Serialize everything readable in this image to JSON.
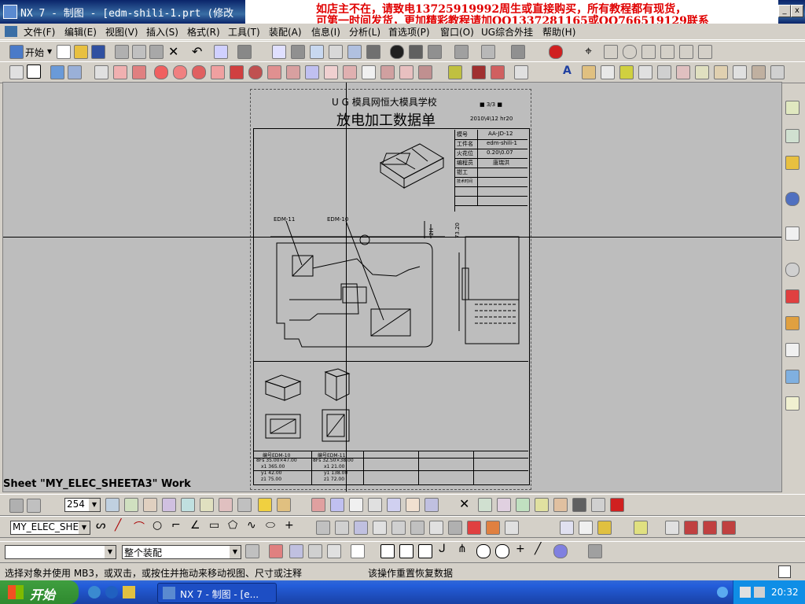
{
  "window": {
    "title": "NX 7 - 制图 - [edm-shili-1.prt (修改",
    "minimize_glyph": "_",
    "close_glyph": "x"
  },
  "promo": {
    "line1": "如店主不在，请致电13725919992周生或直接购买，所有教程都有现货，",
    "line2": "可第一时间发货，更加精彩教程请加QQ1337281165或QQ766519129联系"
  },
  "menubar": {
    "items": [
      "文件(F)",
      "编辑(E)",
      "视图(V)",
      "插入(S)",
      "格式(R)",
      "工具(T)",
      "装配(A)",
      "信息(I)",
      "分析(L)",
      "首选项(P)",
      "窗口(O)",
      "UG综合外挂",
      "帮助(H)"
    ]
  },
  "toolbar1": {
    "start_label": "开始"
  },
  "drawing": {
    "school": "U G 模具网恒大模具学校",
    "title": "放电加工数据单",
    "sheet_no": "■ 3/3 ■",
    "date": "2010\\4\\12 hr20",
    "info_rows": [
      {
        "label": "模号",
        "value": "AA-JD-12"
      },
      {
        "label": "工件名",
        "value": "edm-shili-1"
      },
      {
        "label": "火花位",
        "value": "0.20\\0.07"
      },
      {
        "label": "编程员",
        "value": "唐瑞洪"
      },
      {
        "label": "钳工",
        "value": ""
      },
      {
        "label": "技术时间",
        "value": ""
      }
    ],
    "edm_labels": [
      "EDM-11",
      "EDM-10"
    ],
    "dim_1": "2H",
    "dim_2": "73.20",
    "bottom_table": {
      "col1": [
        "编号EDM-10",
        "8Fs 35.00×47.00",
        "x1 365.00",
        "y1 42.00",
        "z1 75.00"
      ],
      "col2": [
        "编号EDM-11",
        "8Fs 32.50×38.00",
        "x1 21.00",
        "y1 138.00",
        "z1 72.00"
      ]
    }
  },
  "sheet_label": "Sheet \"MY_ELEC_SHEETA3\" Work",
  "lower": {
    "zoom_value": "254",
    "layer_value": "MY_ELEC_SHE",
    "filter_value": "",
    "assembly_value": "整个装配"
  },
  "status": {
    "left": "选择对象并使用 MB3，或双击，或按住并拖动来移动视图、尺寸或注释",
    "right": "该操作重置恢复数据"
  },
  "taskbar": {
    "start": "开始",
    "task": "NX 7 - 制图 - [e...",
    "clock": "20:32"
  },
  "colors": {
    "title_bg": "#0a246a",
    "promo_text": "#e00000",
    "canvas_bg": "#bdbdbd",
    "taskbar_bg": "#245edb",
    "start_bg": "#2f8a2f"
  }
}
